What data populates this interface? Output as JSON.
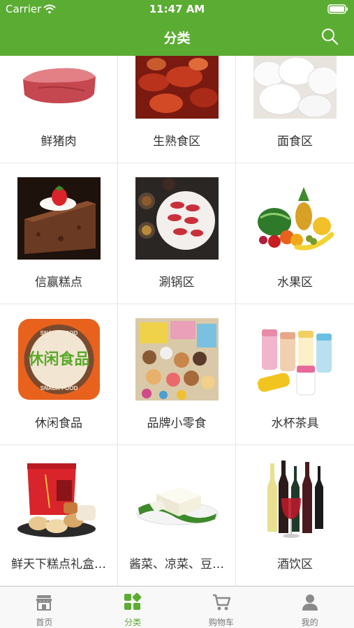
{
  "status": {
    "carrier": "Carrier",
    "time": "11:47 AM"
  },
  "header": {
    "title": "分类"
  },
  "categories": [
    {
      "label": "鲜猪肉",
      "icon": "pork-image"
    },
    {
      "label": "生熟食区",
      "icon": "roast-duck-image"
    },
    {
      "label": "面食区",
      "icon": "steamed-buns-image"
    },
    {
      "label": "信赢糕点",
      "icon": "cake-image"
    },
    {
      "label": "涮锅区",
      "icon": "hotpot-image"
    },
    {
      "label": "水果区",
      "icon": "fruit-image"
    },
    {
      "label": "休闲食品",
      "icon": "snack-food-logo-image"
    },
    {
      "label": "品牌小零食",
      "icon": "snacks-image"
    },
    {
      "label": "水杯茶具",
      "icon": "cups-image"
    },
    {
      "label": "鲜天下糕点礼盒…",
      "icon": "pastry-gift-box-image"
    },
    {
      "label": "酱菜、凉菜、豆…",
      "icon": "tofu-image"
    },
    {
      "label": "酒饮区",
      "icon": "wine-image"
    }
  ],
  "tabs": [
    {
      "label": "首页",
      "icon": "store-icon"
    },
    {
      "label": "分类",
      "icon": "category-icon"
    },
    {
      "label": "购物车",
      "icon": "cart-icon"
    },
    {
      "label": "我的",
      "icon": "user-icon"
    }
  ],
  "colors": {
    "accent": "#5bac33",
    "tab_inactive": "#777777"
  },
  "snack_logo": {
    "top": "SNACK FOOD",
    "main": "休闲食品",
    "bottom": "SNACK FOOD"
  }
}
